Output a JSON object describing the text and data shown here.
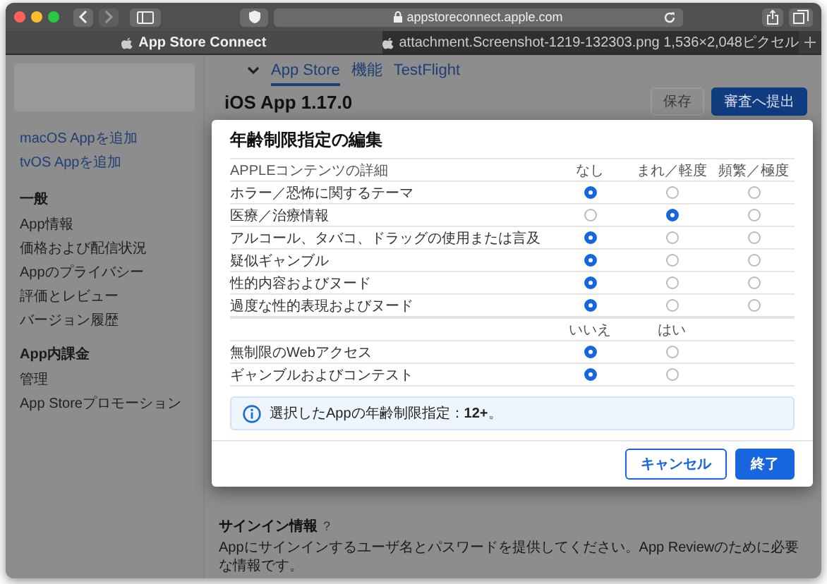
{
  "browser": {
    "url": "appstoreconnect.apple.com",
    "tabs": [
      {
        "title": "App Store Connect",
        "selected": true
      },
      {
        "title": "attachment.Screenshot-1219-132303.png 1,536×2,048ピクセル",
        "selected": false
      }
    ]
  },
  "nav": {
    "tabs": [
      {
        "label": "App Store",
        "selected": true
      },
      {
        "label": "機能",
        "selected": false
      },
      {
        "label": "TestFlight",
        "selected": false
      }
    ]
  },
  "sidebar": {
    "links": [
      "macOS Appを追加",
      "tvOS Appを追加"
    ],
    "sections": [
      {
        "heading": "一般",
        "items": [
          "App情報",
          "価格および配信状況",
          "Appのプライバシー",
          "評価とレビュー",
          "バージョン履歴"
        ]
      },
      {
        "heading": "App内課金",
        "items": [
          "管理",
          "App Storeプロモーション"
        ]
      }
    ]
  },
  "page": {
    "title": "iOS App 1.17.0",
    "buttons": [
      {
        "label": "保存",
        "primary": false,
        "disabled": true
      },
      {
        "label": "審査へ提出",
        "primary": true,
        "disabled": false
      }
    ]
  },
  "dialog": {
    "title": "年齢制限指定の編集",
    "groups": [
      {
        "heading": "APPLEコンテンツの詳細",
        "columns": [
          "なし",
          "まれ／軽度",
          "頻繁／極度"
        ],
        "rows": [
          {
            "label": "ホラー／恐怖に関するテーマ",
            "options": [
              {
                "selected": true
              },
              {
                "selected": false
              },
              {
                "selected": false
              }
            ]
          },
          {
            "label": "医療／治療情報",
            "options": [
              {
                "selected": false
              },
              {
                "selected": true
              },
              {
                "selected": false
              }
            ]
          },
          {
            "label": "アルコール、タバコ、ドラッグの使用または言及",
            "options": [
              {
                "selected": true
              },
              {
                "selected": false
              },
              {
                "selected": false
              }
            ]
          },
          {
            "label": "疑似ギャンブル",
            "options": [
              {
                "selected": true
              },
              {
                "selected": false
              },
              {
                "selected": false
              }
            ]
          },
          {
            "label": "性的内容およびヌード",
            "options": [
              {
                "selected": true
              },
              {
                "selected": false
              },
              {
                "selected": false
              }
            ]
          },
          {
            "label": "過度な性的表現およびヌード",
            "options": [
              {
                "selected": true
              },
              {
                "selected": false
              },
              {
                "selected": false
              }
            ]
          }
        ]
      },
      {
        "columns": [
          "いいえ",
          "はい"
        ],
        "rows": [
          {
            "label": "無制限のWebアクセス",
            "options": [
              {
                "selected": true
              },
              {
                "selected": false
              }
            ]
          },
          {
            "label": "ギャンブルおよびコンテスト",
            "options": [
              {
                "selected": true
              },
              {
                "selected": false
              }
            ]
          }
        ]
      }
    ],
    "info": "選択したAppの年齢制限指定：**12+**。",
    "buttons": [
      {
        "label": "キャンセル",
        "primary": false
      },
      {
        "label": "終了",
        "primary": true
      }
    ]
  },
  "sign_in": {
    "heading": "サインイン情報",
    "help": "?",
    "text": "Appにサインインするユーザ名とパスワードを提供してください。App Reviewのために必要な情報です。"
  }
}
